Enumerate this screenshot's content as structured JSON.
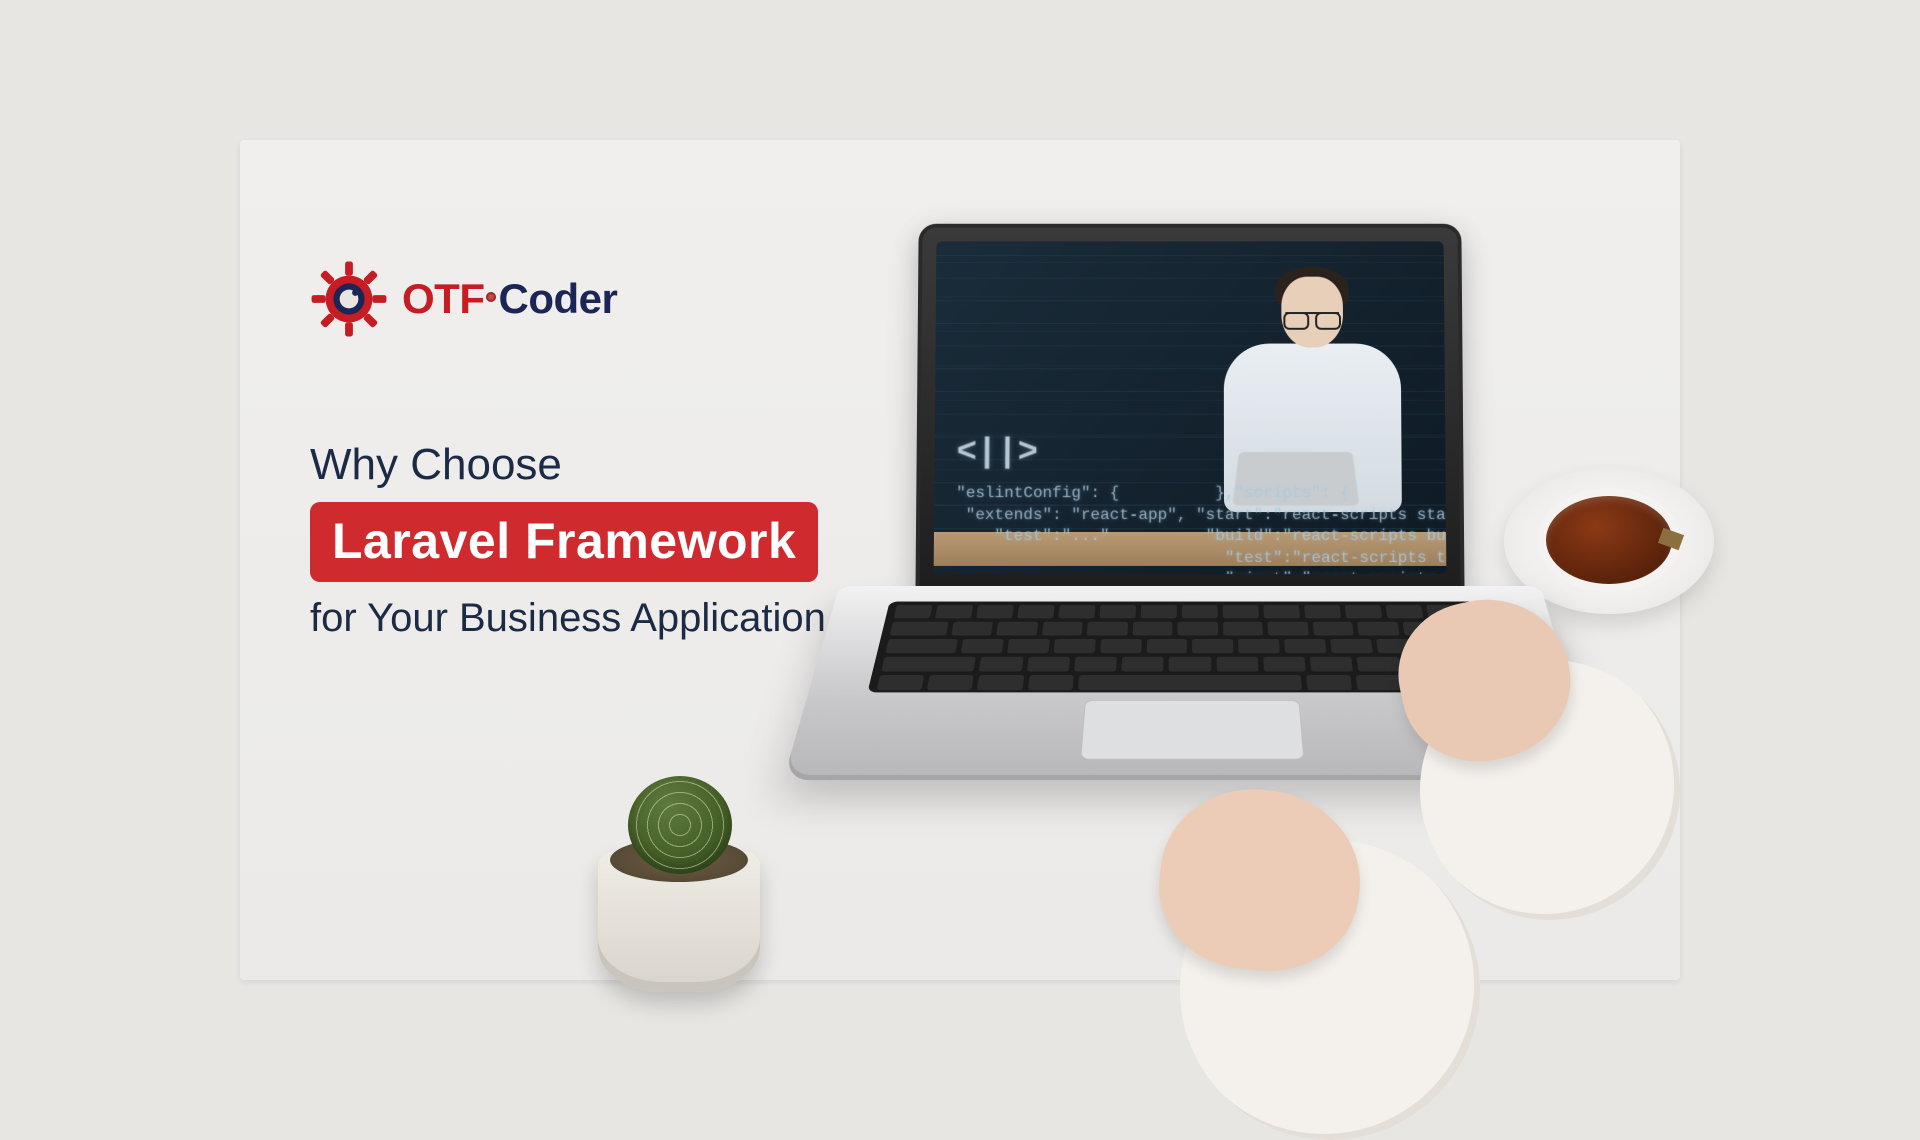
{
  "logo": {
    "brand_part1": "OTF",
    "brand_part2": "Coder"
  },
  "headline": {
    "line1": "Why Choose",
    "highlight": "Laravel Framework",
    "line3": "for Your Business Application"
  },
  "screen": {
    "code_tag": "<||>",
    "code_lines": "\"eslintConfig\": {          },\"scripts\": {\n \"extends\": \"react-app\", \"start\":\"react-scripts start\",\n    \"test\":\"...\"          \"build\":\"react-scripts build\",\n                            \"test\":\"react-scripts test\",\n                            \"eject\":\"react-scripts eject\""
  },
  "colors": {
    "brand_red": "#cf2a2e",
    "brand_navy": "#1b2656",
    "text_navy": "#1c2b45"
  }
}
